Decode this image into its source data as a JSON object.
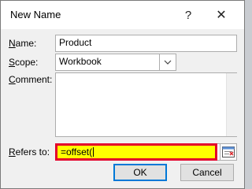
{
  "dialog": {
    "title": "New Name",
    "help_glyph": "?",
    "close_glyph": "✕"
  },
  "form": {
    "name_label_key": "N",
    "name_label_rest": "ame:",
    "name_value": "Product",
    "scope_label_key": "S",
    "scope_label_rest": "cope:",
    "scope_value": "Workbook",
    "comment_label_key": "C",
    "comment_label_rest": "omment:",
    "comment_value": "",
    "refers_label_key": "R",
    "refers_label_rest": "efers to:",
    "refers_value": "=offset("
  },
  "buttons": {
    "ok": "OK",
    "cancel": "Cancel"
  },
  "colors": {
    "highlight": "#ffff00",
    "highlight_border": "#e4002b",
    "focus": "#0078d7"
  },
  "icons": {
    "help": "help-icon",
    "close": "close-icon",
    "dropdown": "chevron-down-icon",
    "collapse": "collapse-dialog-icon"
  }
}
